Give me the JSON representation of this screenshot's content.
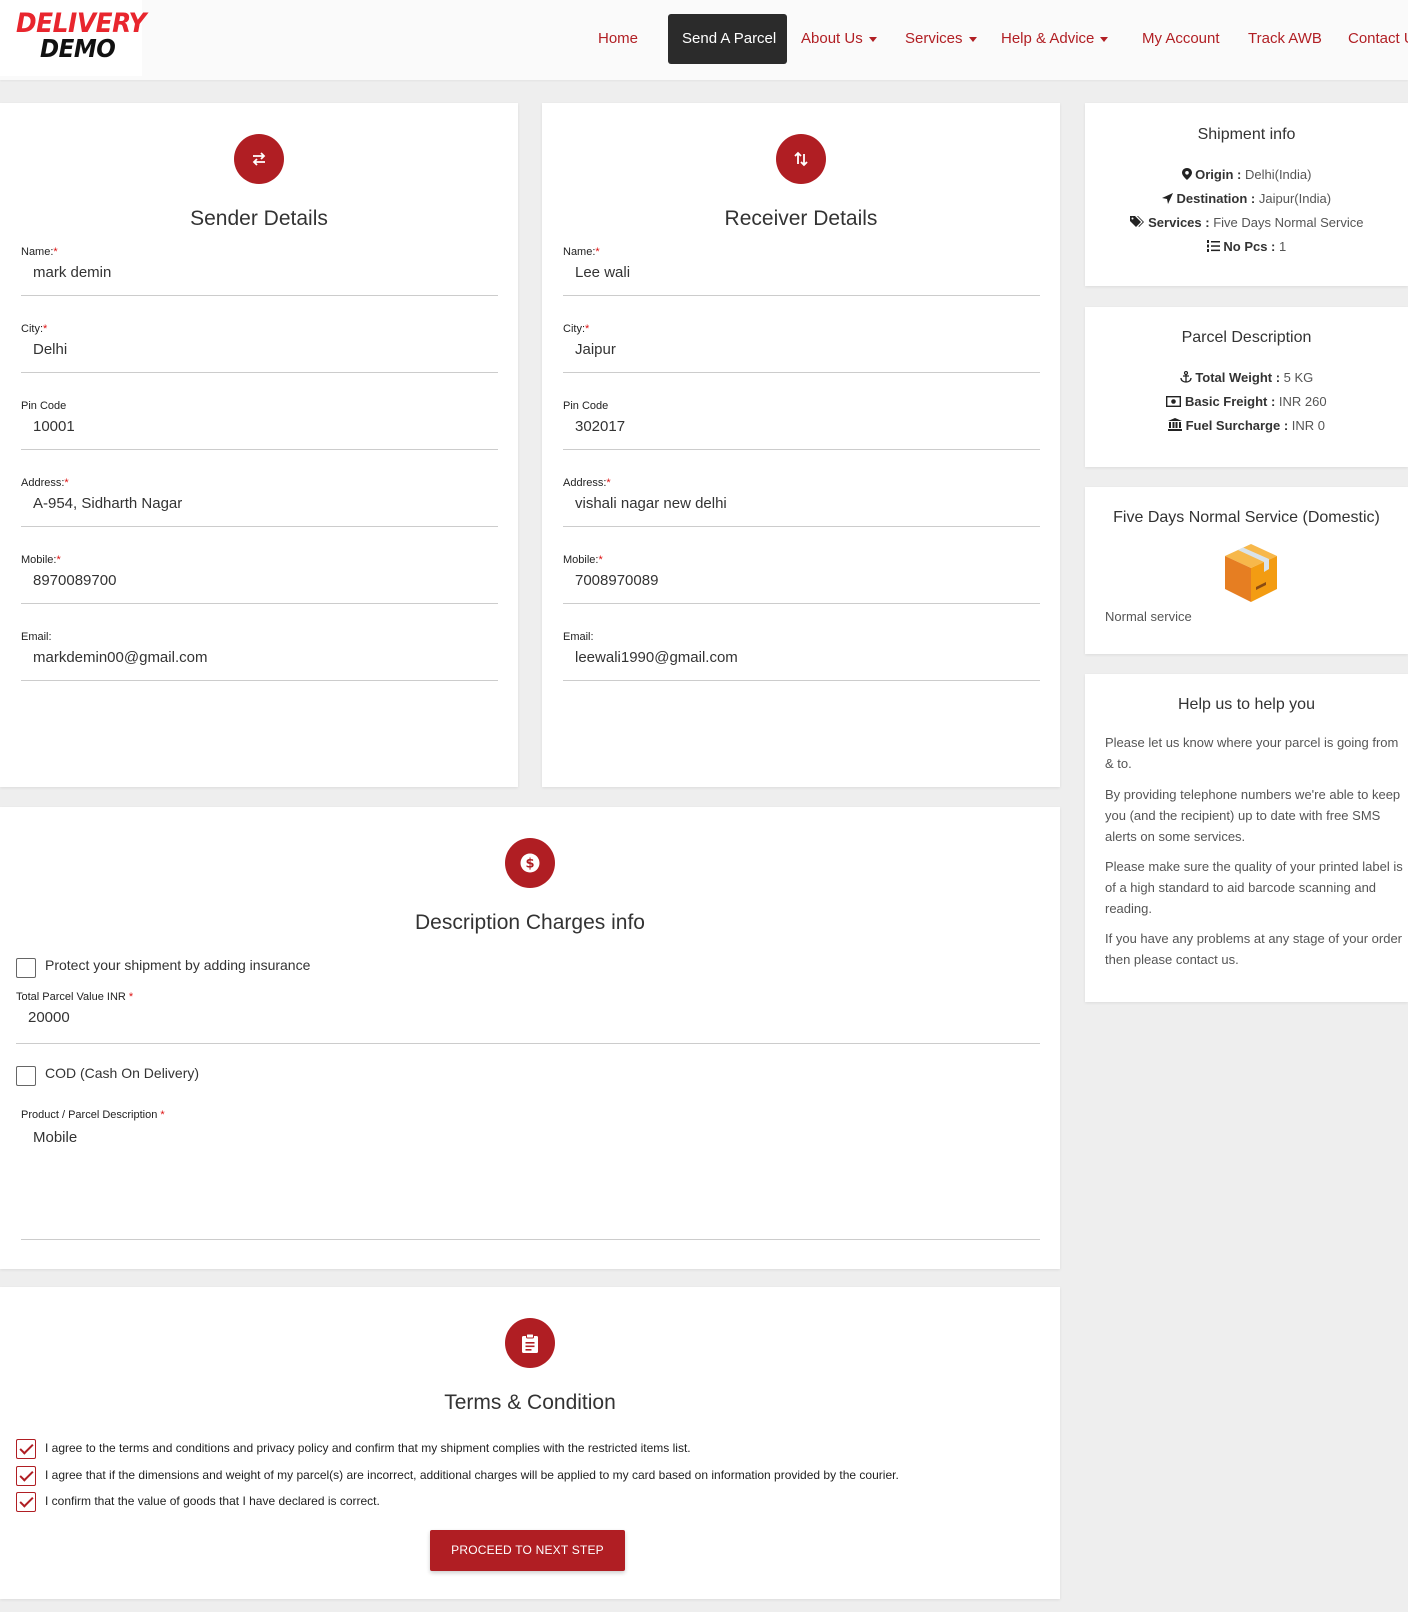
{
  "brand": {
    "line1": "DELIVERY",
    "line2": "DEMO"
  },
  "nav": {
    "home": "Home",
    "send_parcel": "Send A Parcel",
    "about": "About Us",
    "services": "Services",
    "help": "Help & Advice",
    "account": "My Account",
    "track": "Track AWB",
    "contact": "Contact U"
  },
  "sender": {
    "title": "Sender Details",
    "name_label": "Name:",
    "name": "mark demin",
    "city_label": "City:",
    "city": "Delhi",
    "pin_label": "Pin Code",
    "pin": "10001",
    "address_label": "Address:",
    "address": "A-954, Sidharth Nagar",
    "mobile_label": "Mobile:",
    "mobile": "8970089700",
    "email_label": "Email:",
    "email": "markdemin00@gmail.com"
  },
  "receiver": {
    "title": "Receiver Details",
    "name_label": "Name:",
    "name": "Lee wali",
    "city_label": "City:",
    "city": "Jaipur",
    "pin_label": "Pin Code",
    "pin": "302017",
    "address_label": "Address:",
    "address": "vishali nagar new delhi",
    "mobile_label": "Mobile:",
    "mobile": "7008970089",
    "email_label": "Email:",
    "email": "leewali1990@gmail.com"
  },
  "shipment_info": {
    "title": "Shipment info",
    "origin_label": "Origin :",
    "origin": "Delhi(India)",
    "destination_label": "Destination :",
    "destination": "Jaipur(India)",
    "services_label": "Services :",
    "services": "Five Days Normal Service",
    "pcs_label": "No Pcs :",
    "pcs": "1"
  },
  "parcel_description": {
    "title": "Parcel Description",
    "weight_label": "Total Weight :",
    "weight": "5 KG",
    "freight_label": "Basic Freight :",
    "freight": "INR 260",
    "fuel_label": "Fuel Surcharge :",
    "fuel": "INR 0"
  },
  "service_card": {
    "title": "Five Days Normal Service (Domestic)",
    "subtitle": "Normal service"
  },
  "help": {
    "title": "Help us to help you",
    "p1": "Please let us know where your parcel is going from & to.",
    "p2": "By providing telephone numbers we're able to keep you (and the recipient) up to date with free SMS alerts on some services.",
    "p3": "Please make sure the quality of your printed label is of a high standard to aid barcode scanning and reading.",
    "p4": "If you have any problems at any stage of your order then please contact us."
  },
  "charges": {
    "title": "Description Charges info",
    "insurance_label": "Protect your shipment by adding insurance",
    "insurance_checked": false,
    "value_label": "Total Parcel Value INR",
    "value": "20000",
    "cod_label": "COD (Cash On Delivery)",
    "cod_checked": false,
    "desc_label": "Product / Parcel Description",
    "desc": "Mobile"
  },
  "terms": {
    "title": "Terms & Condition",
    "t1": "I agree to the terms and conditions and privacy policy and confirm that my shipment complies with the restricted items list.",
    "t2": "I agree that if the dimensions and weight of my parcel(s) are incorrect, additional charges will be applied to my card based on information provided by the courier.",
    "t3": "I confirm that the value of goods that I have declared is correct.",
    "all_checked": true,
    "proceed": "PROCEED TO NEXT STEP"
  },
  "colors": {
    "accent": "#b01e23",
    "brand_red": "#e8262e",
    "nav_active_bg": "#2b2b2b"
  },
  "icons": {
    "sender": "swap-horizontal-icon",
    "receiver": "swap-vertical-icon",
    "charges": "dollar-circle-icon",
    "terms": "clipboard-icon",
    "origin": "map-marker-icon",
    "destination": "location-arrow-icon",
    "services": "tags-icon",
    "pcs": "list-ordered-icon",
    "weight": "anchor-icon",
    "freight": "money-icon",
    "fuel": "bank-icon",
    "service_image": "box-icon"
  }
}
